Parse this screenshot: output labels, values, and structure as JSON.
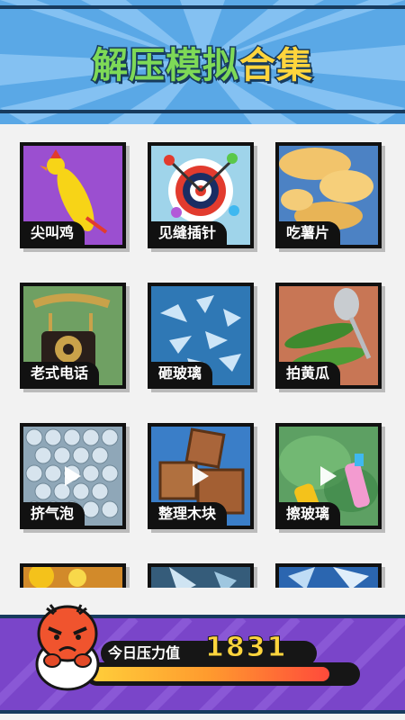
{
  "header": {
    "title_part1": "解压模拟",
    "title_part2": "合集"
  },
  "games": [
    {
      "label": "尖叫鸡",
      "has_video": false
    },
    {
      "label": "见缝插针",
      "has_video": false
    },
    {
      "label": "吃薯片",
      "has_video": false
    },
    {
      "label": "老式电话",
      "has_video": false
    },
    {
      "label": "砸玻璃",
      "has_video": false
    },
    {
      "label": "拍黄瓜",
      "has_video": false
    },
    {
      "label": "挤气泡",
      "has_video": true
    },
    {
      "label": "整理木块",
      "has_video": true
    },
    {
      "label": "擦玻璃",
      "has_video": true
    }
  ],
  "pressure": {
    "label": "今日压力值",
    "value": "1831",
    "level_fraction": 0.9
  },
  "colors": {
    "header_blue": "#5aa8e6",
    "panel_purple": "#7a45c9",
    "accent_yellow": "#ffd53d",
    "title_green": "#7ed957"
  }
}
